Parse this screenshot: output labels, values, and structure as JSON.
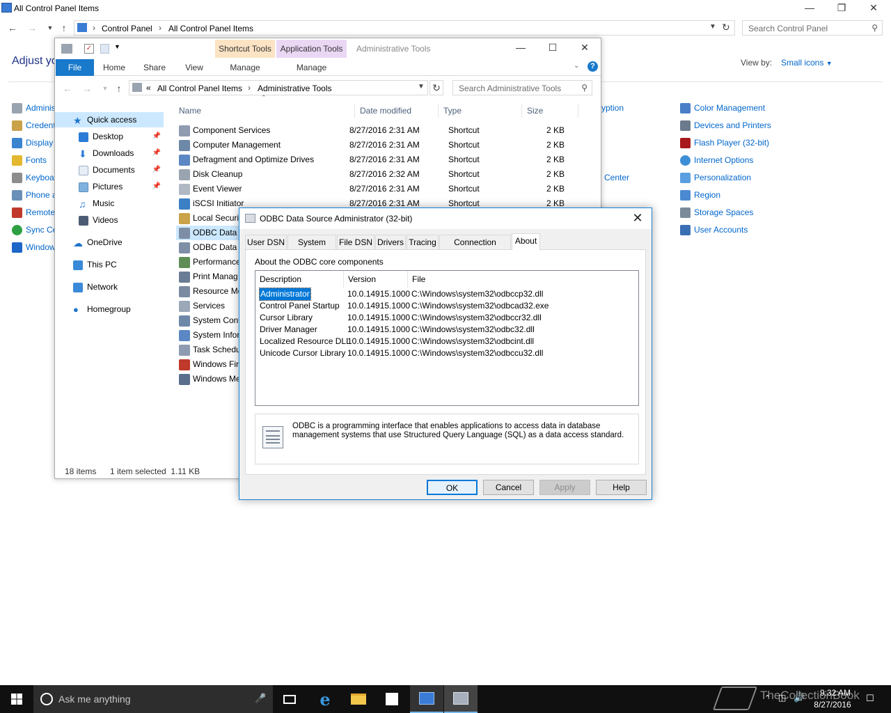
{
  "cp": {
    "title": "All Control Panel Items",
    "breadcrumb": [
      "Control Panel",
      "All Control Panel Items"
    ],
    "search_placeholder": "Search Control Panel",
    "heading": "Adjust yo",
    "view_by_label": "View by:",
    "view_by_value": "Small icons",
    "left_items": [
      "Adminis",
      "Credent",
      "Display",
      "Fonts",
      "Keyboa",
      "Phone a",
      "Remote",
      "Sync Ce",
      "Window"
    ],
    "mid_items": [
      "yption",
      "g Center"
    ],
    "right_items": [
      "Color Management",
      "Devices and Printers",
      "Flash Player (32-bit)",
      "Internet Options",
      "Personalization",
      "Region",
      "Storage Spaces",
      "User Accounts"
    ]
  },
  "ex": {
    "title": "Administrative Tools",
    "shortcut_tools": "Shortcut Tools",
    "application_tools": "Application Tools",
    "tabs": [
      "File",
      "Home",
      "Share",
      "View",
      "Manage",
      "Manage"
    ],
    "breadcrumb_prefix": "«",
    "breadcrumb": [
      "All Control Panel Items",
      "Administrative Tools"
    ],
    "search_placeholder": "Search Administrative Tools",
    "nav": [
      "Quick access",
      "Desktop",
      "Downloads",
      "Documents",
      "Pictures",
      "Music",
      "Videos",
      "OneDrive",
      "This PC",
      "Network",
      "Homegroup"
    ],
    "columns": [
      "Name",
      "Date modified",
      "Type",
      "Size"
    ],
    "files": [
      {
        "name": "Component Services",
        "date": "8/27/2016 2:31 AM",
        "type": "Shortcut",
        "size": "2 KB"
      },
      {
        "name": "Computer Management",
        "date": "8/27/2016 2:31 AM",
        "type": "Shortcut",
        "size": "2 KB"
      },
      {
        "name": "Defragment and Optimize Drives",
        "date": "8/27/2016 2:31 AM",
        "type": "Shortcut",
        "size": "2 KB"
      },
      {
        "name": "Disk Cleanup",
        "date": "8/27/2016 2:32 AM",
        "type": "Shortcut",
        "size": "2 KB"
      },
      {
        "name": "Event Viewer",
        "date": "8/27/2016 2:31 AM",
        "type": "Shortcut",
        "size": "2 KB"
      },
      {
        "name": "iSCSI Initiator",
        "date": "8/27/2016 2:31 AM",
        "type": "Shortcut",
        "size": "2 KB"
      },
      {
        "name": "Local Securit",
        "date": "",
        "type": "",
        "size": ""
      },
      {
        "name": "ODBC Data S",
        "date": "",
        "type": "",
        "size": ""
      },
      {
        "name": "ODBC Data S",
        "date": "",
        "type": "",
        "size": ""
      },
      {
        "name": "Performance",
        "date": "",
        "type": "",
        "size": ""
      },
      {
        "name": "Print Manag",
        "date": "",
        "type": "",
        "size": ""
      },
      {
        "name": "Resource Mo",
        "date": "",
        "type": "",
        "size": ""
      },
      {
        "name": "Services",
        "date": "",
        "type": "",
        "size": ""
      },
      {
        "name": "System Conf",
        "date": "",
        "type": "",
        "size": ""
      },
      {
        "name": "System Infor",
        "date": "",
        "type": "",
        "size": ""
      },
      {
        "name": "Task Schedu",
        "date": "",
        "type": "",
        "size": ""
      },
      {
        "name": "Windows Fir",
        "date": "",
        "type": "",
        "size": ""
      },
      {
        "name": "Windows Me",
        "date": "",
        "type": "",
        "size": ""
      }
    ],
    "status_count": "18 items",
    "status_selected": "1 item selected  1.11 KB"
  },
  "dlg": {
    "title": "ODBC Data Source Administrator (32-bit)",
    "tabs": [
      "User DSN",
      "System DSN",
      "File DSN",
      "Drivers",
      "Tracing",
      "Connection Pooling",
      "About"
    ],
    "section_label": "About the ODBC core components",
    "columns": [
      "Description",
      "Version",
      "File"
    ],
    "rows": [
      {
        "desc": "Administrator",
        "ver": "10.0.14915.1000",
        "file": "C:\\Windows\\system32\\odbccp32.dll"
      },
      {
        "desc": "Control Panel Startup",
        "ver": "10.0.14915.1000",
        "file": "C:\\Windows\\system32\\odbcad32.exe"
      },
      {
        "desc": "Cursor Library",
        "ver": "10.0.14915.1000",
        "file": "C:\\Windows\\system32\\odbccr32.dll"
      },
      {
        "desc": "Driver Manager",
        "ver": "10.0.14915.1000",
        "file": "C:\\Windows\\system32\\odbc32.dll"
      },
      {
        "desc": "Localized Resource DLL",
        "ver": "10.0.14915.1000",
        "file": "C:\\Windows\\system32\\odbcint.dll"
      },
      {
        "desc": "Unicode Cursor Library",
        "ver": "10.0.14915.1000",
        "file": "C:\\Windows\\system32\\odbccu32.dll"
      }
    ],
    "info": "ODBC is a programming interface that enables applications to access data in database management systems that use Structured Query Language (SQL) as a data access standard.",
    "buttons": {
      "ok": "OK",
      "cancel": "Cancel",
      "apply": "Apply",
      "help": "Help"
    }
  },
  "taskbar": {
    "search_placeholder": "Ask me anything",
    "time": "9:32 AM",
    "date": "8/27/2016",
    "watermark": "TheCollectionBook"
  },
  "colors": {
    "accent": "#0078d7",
    "link": "#0066cc",
    "taskbar": "#101010"
  }
}
